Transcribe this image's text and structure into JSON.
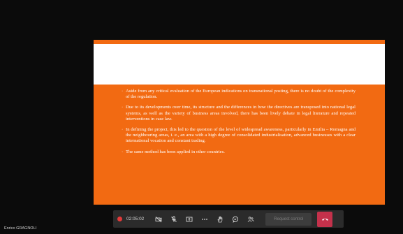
{
  "slide": {
    "bullets": [
      "Aside from any critical evaluation of the European indications on transnational posting, there is no doubt of the complexity of the regulation.",
      "Due to its developments over time, its structure and the differences in how the directives are transposed into national legal systems, as well as the variety of business areas involved, there has been lively debate in legal literature and repeated interventions in case law.",
      "In defining the project, this led to the question of the level of widespread awareness, particularly in Emilia – Romagna and the neighbouring areas, i. e., an area with a high degree of consolidated industrialisation, advanced businesses with a clear international vocation and constant trading.",
      "The same method has been applied in other countries."
    ],
    "bullet_mark": "·"
  },
  "call_controls": {
    "timer": "02:05:02",
    "request_control_label": "Request control"
  },
  "participant": {
    "name": "Enrico GRAGNOLI"
  },
  "colors": {
    "slide_accent": "#f26a12",
    "hangup": "#c4314b",
    "recording": "#e23a3a"
  }
}
